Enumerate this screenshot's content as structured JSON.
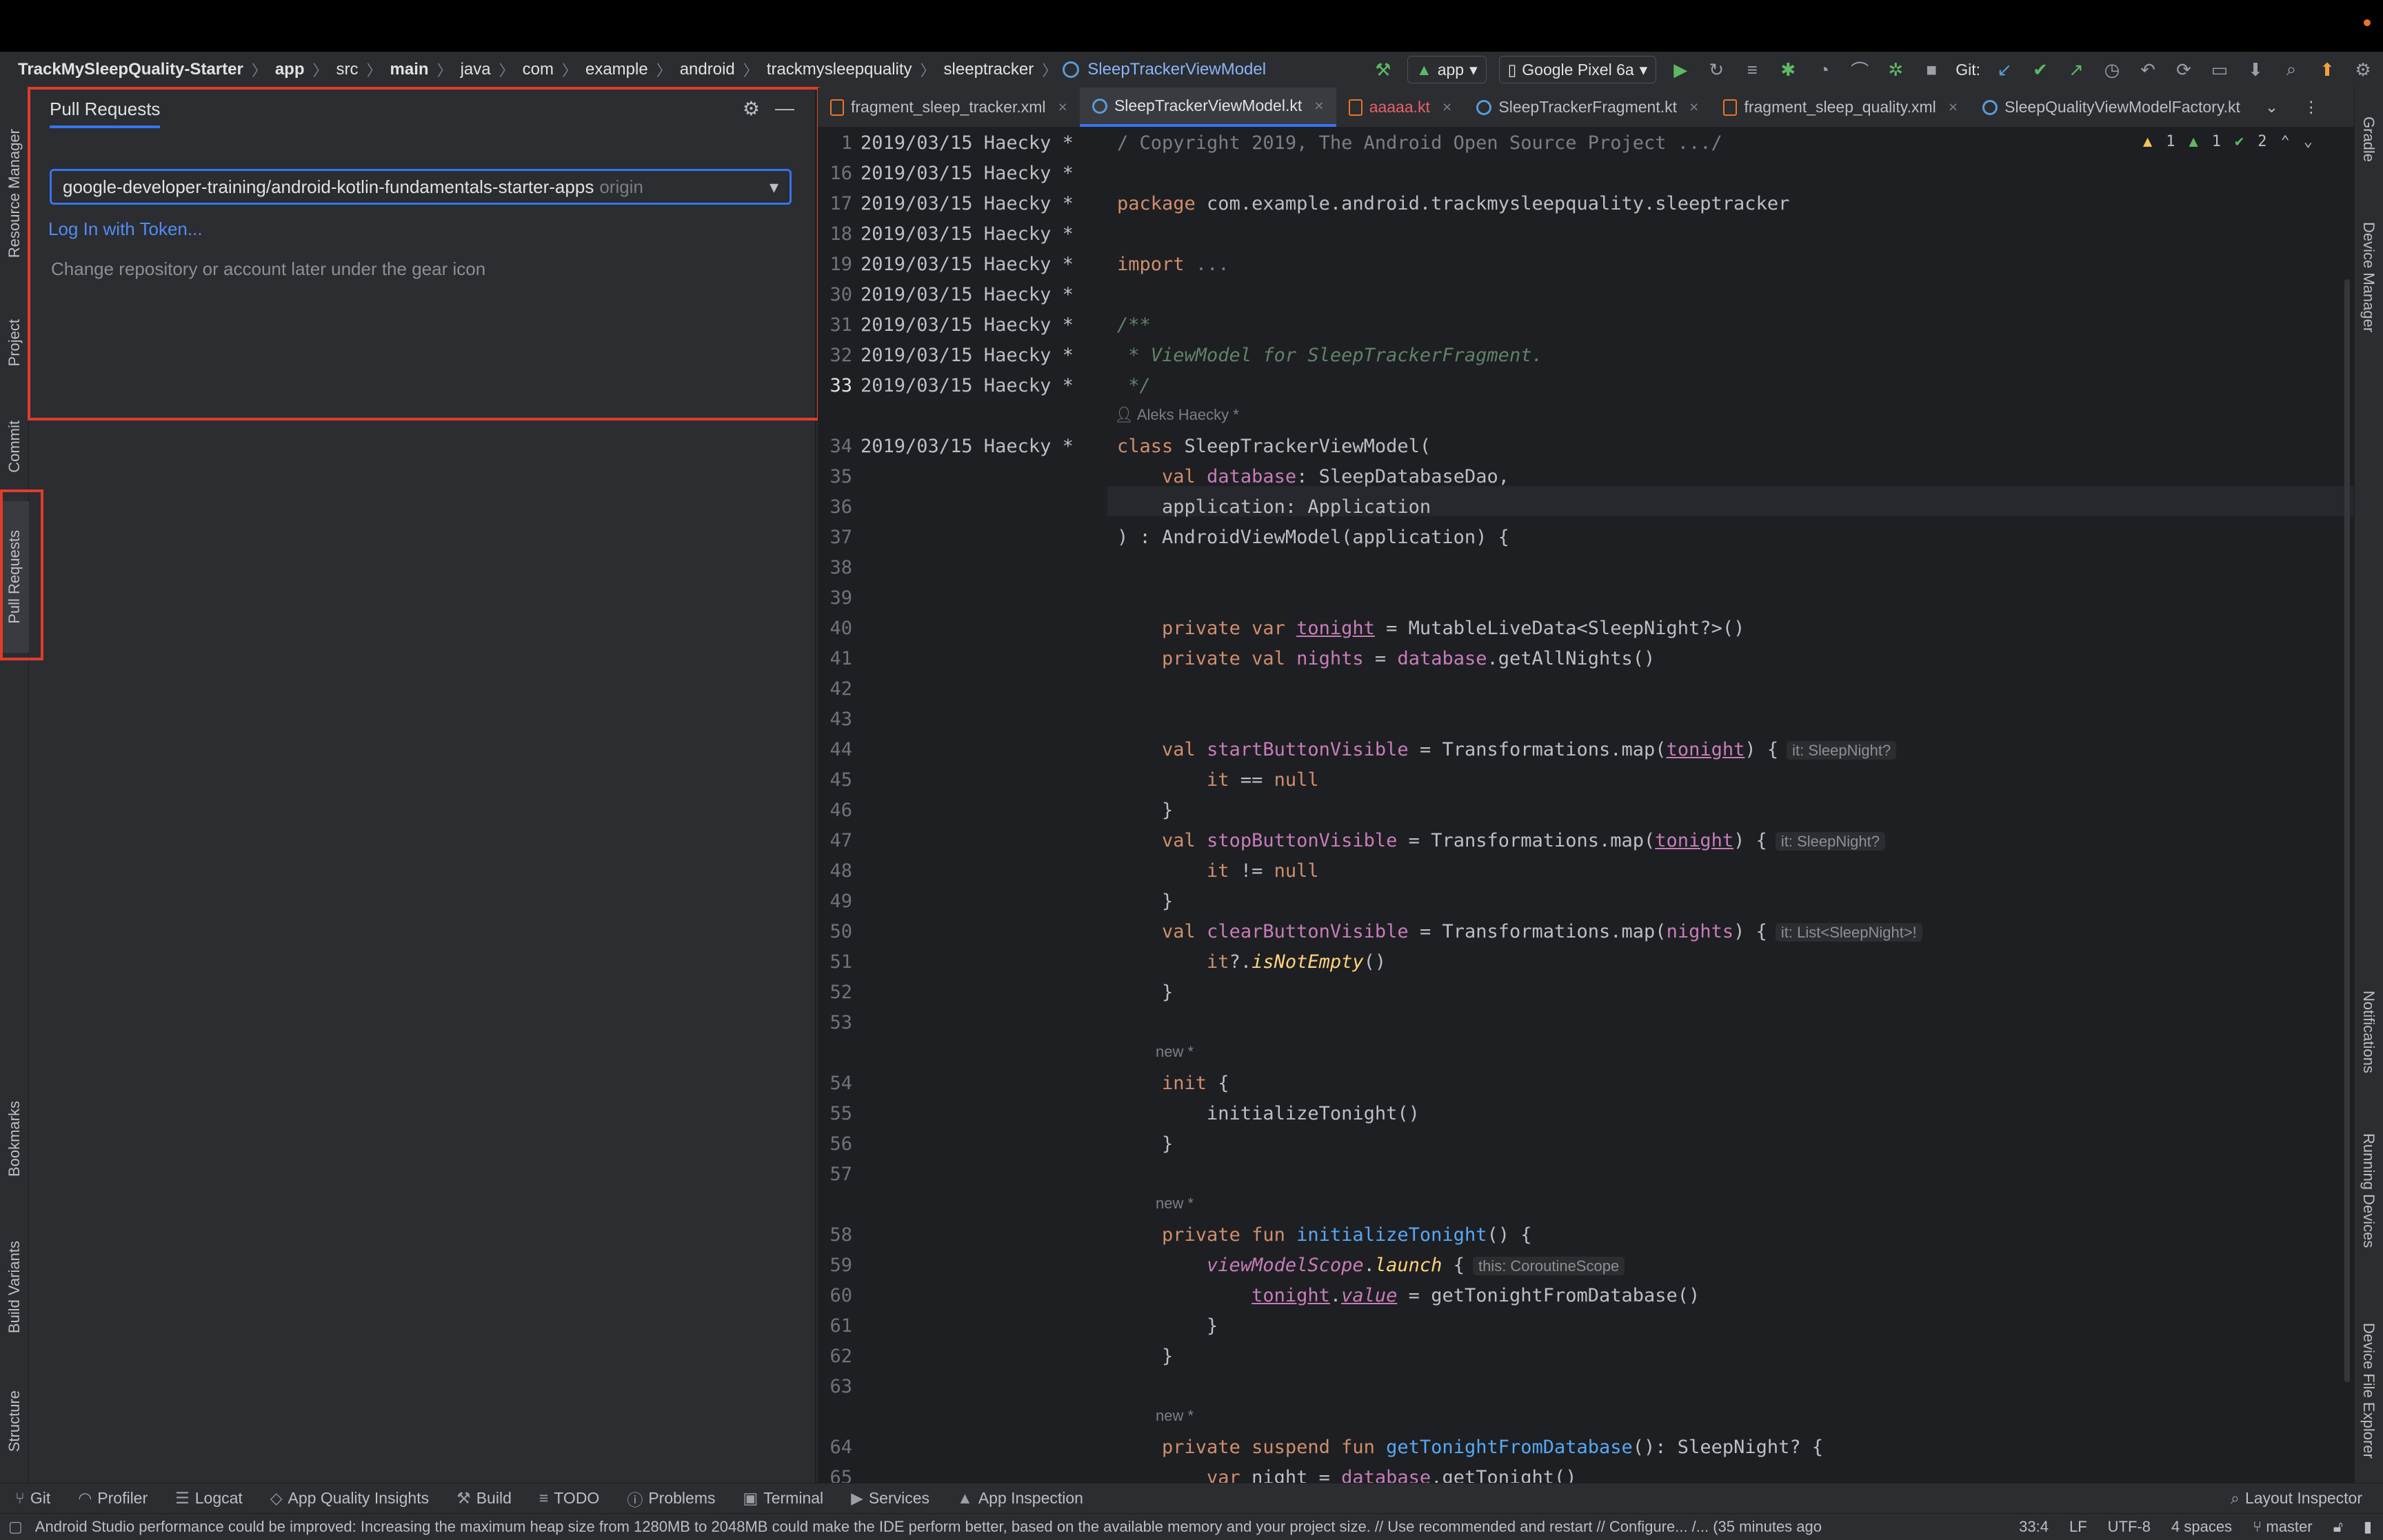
{
  "breadcrumb": {
    "items": [
      "TrackMySleepQuality-Starter",
      "app",
      "src",
      "main",
      "java",
      "com",
      "example",
      "android",
      "trackmysleepquality",
      "sleeptracker"
    ],
    "file": "SleepTrackerViewModel"
  },
  "toolbar": {
    "config": "app",
    "device": "Google Pixel 6a",
    "git_label": "Git:"
  },
  "left_tools": {
    "resource_manager": "Resource Manager",
    "project": "Project",
    "commit": "Commit",
    "pull_requests": "Pull Requests",
    "bookmarks": "Bookmarks",
    "build_variants": "Build Variants",
    "structure": "Structure"
  },
  "right_tools": {
    "gradle": "Gradle",
    "device_manager": "Device Manager",
    "notifications": "Notifications",
    "running_devices": "Running Devices",
    "device_file_explorer": "Device File Explorer"
  },
  "pr_panel": {
    "title": "Pull Requests",
    "repo": "google-developer-training/android-kotlin-fundamentals-starter-apps",
    "remote": "origin",
    "login_link": "Log In with Token...",
    "hint": "Change repository or account later under the gear icon"
  },
  "tabs": [
    {
      "label": "fragment_sleep_tracker.xml"
    },
    {
      "label": "SleepTrackerViewModel.kt"
    },
    {
      "label": "aaaaa.kt"
    },
    {
      "label": "SleepTrackerFragment.kt"
    },
    {
      "label": "fragment_sleep_quality.xml"
    },
    {
      "label": "SleepQualityViewModelFactory.kt"
    }
  ],
  "inspections": {
    "warnings": "1",
    "weak_warnings": "1",
    "ok": "2"
  },
  "editor": {
    "annotation": "2019/03/15 Haecky *",
    "author_hint": "Aleks Haecky *",
    "new_hint": "new *",
    "line_numbers": [
      "1",
      "16",
      "17",
      "18",
      "19",
      "30",
      "31",
      "32",
      "33",
      "34",
      "35",
      "36",
      "37",
      "38",
      "39",
      "40",
      "41",
      "42",
      "43",
      "44",
      "45",
      "46",
      "47",
      "48",
      "49",
      "50",
      "51",
      "52",
      "53",
      "54",
      "55",
      "56",
      "57",
      "58",
      "59",
      "60",
      "61",
      "62",
      "63",
      "64",
      "65"
    ],
    "inlay_tonight": "it: SleepNight?",
    "inlay_nights": "it: List<SleepNight>!",
    "inlay_scope": "this: CoroutineScope"
  },
  "bottom_tools": [
    "Git",
    "Profiler",
    "Logcat",
    "App Quality Insights",
    "Build",
    "TODO",
    "Problems",
    "Terminal",
    "Services",
    "App Inspection"
  ],
  "layout_inspector": "Layout Inspector",
  "status": {
    "message": "Android Studio performance could be improved: Increasing the maximum heap size from 1280MB to 2048MB could make the IDE perform better, based on the available memory and your project size. // Use recommended and restart // Configure... /... (35 minutes ago",
    "position": "33:4",
    "line_sep": "LF",
    "encoding": "UTF-8",
    "indent": "4 spaces",
    "branch": "master"
  }
}
